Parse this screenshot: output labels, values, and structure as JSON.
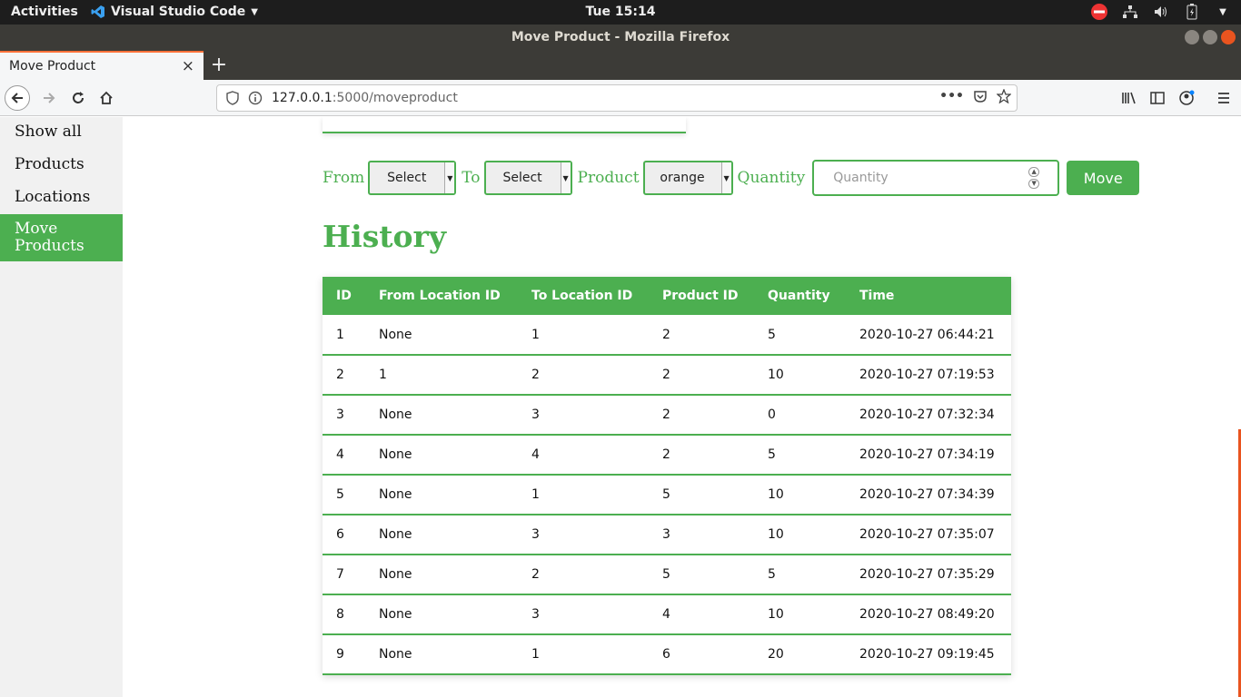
{
  "system_bar": {
    "activities": "Activities",
    "app_name": "Visual Studio Code",
    "clock": "Tue 15:14"
  },
  "window": {
    "title": "Move Product - Mozilla Firefox"
  },
  "browser": {
    "tab_title": "Move Product",
    "url_host": "127.0.0.1",
    "url_rest": ":5000/moveproduct"
  },
  "sidebar": {
    "items": [
      {
        "label": "Show all"
      },
      {
        "label": "Products"
      },
      {
        "label": "Locations"
      },
      {
        "label": "Move Products"
      }
    ]
  },
  "form": {
    "from_label": "From",
    "from_value": "Select",
    "to_label": "To",
    "to_value": "Select",
    "product_label": "Product",
    "product_value": "orange",
    "quantity_label": "Quantity",
    "quantity_placeholder": "Quantity",
    "move_button": "Move"
  },
  "history": {
    "title": "History",
    "columns": [
      "ID",
      "From Location ID",
      "To Location ID",
      "Product ID",
      "Quantity",
      "Time"
    ],
    "rows": [
      [
        "1",
        "None",
        "1",
        "2",
        "5",
        "2020-10-27 06:44:21"
      ],
      [
        "2",
        "1",
        "2",
        "2",
        "10",
        "2020-10-27 07:19:53"
      ],
      [
        "3",
        "None",
        "3",
        "2",
        "0",
        "2020-10-27 07:32:34"
      ],
      [
        "4",
        "None",
        "4",
        "2",
        "5",
        "2020-10-27 07:34:19"
      ],
      [
        "5",
        "None",
        "1",
        "5",
        "10",
        "2020-10-27 07:34:39"
      ],
      [
        "6",
        "None",
        "3",
        "3",
        "10",
        "2020-10-27 07:35:07"
      ],
      [
        "7",
        "None",
        "2",
        "5",
        "5",
        "2020-10-27 07:35:29"
      ],
      [
        "8",
        "None",
        "3",
        "4",
        "10",
        "2020-10-27 08:49:20"
      ],
      [
        "9",
        "None",
        "1",
        "6",
        "20",
        "2020-10-27 09:19:45"
      ]
    ]
  },
  "colors": {
    "accent": "#4caf50",
    "firefox_tab_accent": "#ff7139"
  }
}
